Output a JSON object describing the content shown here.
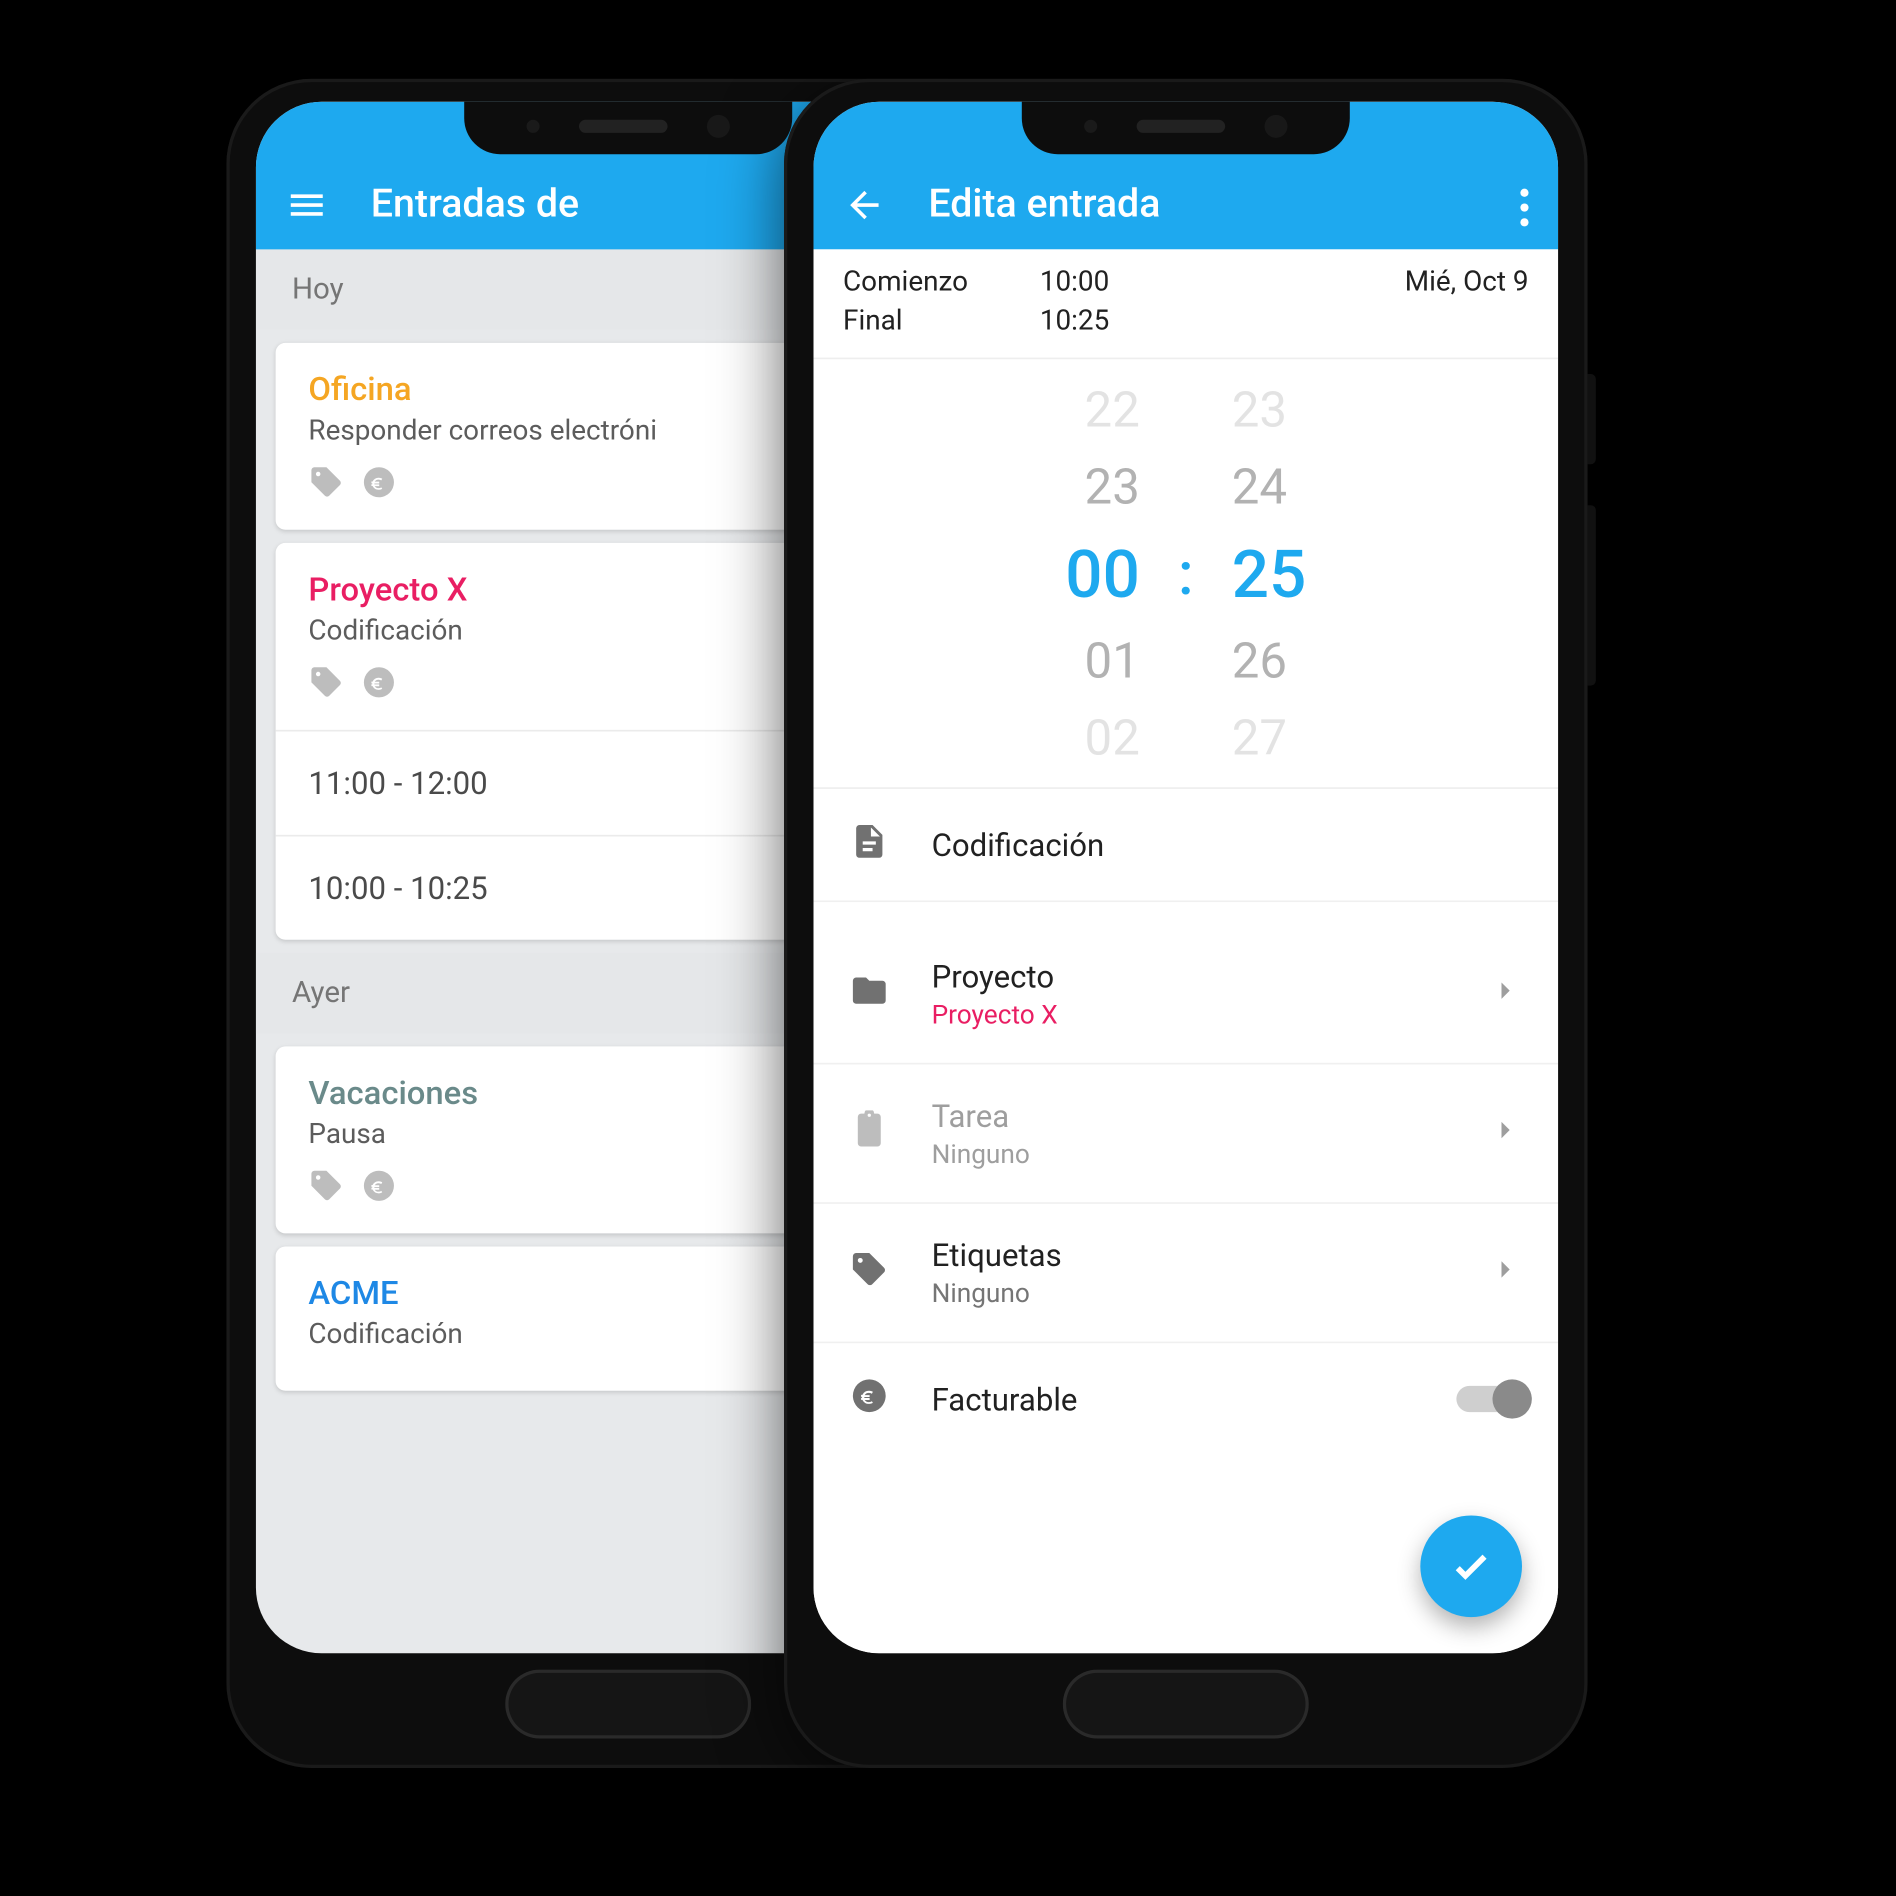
{
  "left": {
    "title": "Entradas de",
    "sections": [
      {
        "header": "Hoy",
        "cards": [
          {
            "entries": [
              {
                "name": "Oficina",
                "nameClass": "c-orange",
                "subtitle": "Responder correos electróni"
              }
            ]
          },
          {
            "entries": [
              {
                "name": "Proyecto X",
                "nameClass": "c-pink",
                "subtitle": "Codificación"
              }
            ],
            "times": [
              "11:00 - 12:00",
              "10:00 - 10:25"
            ]
          }
        ]
      },
      {
        "header": "Ayer",
        "cards": [
          {
            "entries": [
              {
                "name": "Vacaciones",
                "nameClass": "c-teal",
                "subtitle": "Pausa"
              }
            ]
          },
          {
            "entries": [
              {
                "name": "ACME",
                "nameClass": "c-blue",
                "subtitle": "Codificación"
              }
            ]
          }
        ]
      }
    ]
  },
  "right": {
    "title": "Edita entrada",
    "start_label": "Comienzo",
    "end_label": "Final",
    "start_time": "10:00",
    "end_time": "10:25",
    "date": "Mié, Oct 9",
    "picker": {
      "hours": [
        "22",
        "23",
        "00",
        "01",
        "02"
      ],
      "minutes": [
        "23",
        "24",
        "25",
        "26",
        "27"
      ]
    },
    "description": "Codificación",
    "rows": {
      "project": {
        "title": "Proyecto",
        "value": "Proyecto X"
      },
      "task": {
        "title": "Tarea",
        "value": "Ninguno"
      },
      "tags": {
        "title": "Etiquetas",
        "value": "Ninguno"
      },
      "billable": {
        "title": "Facturable"
      }
    }
  }
}
